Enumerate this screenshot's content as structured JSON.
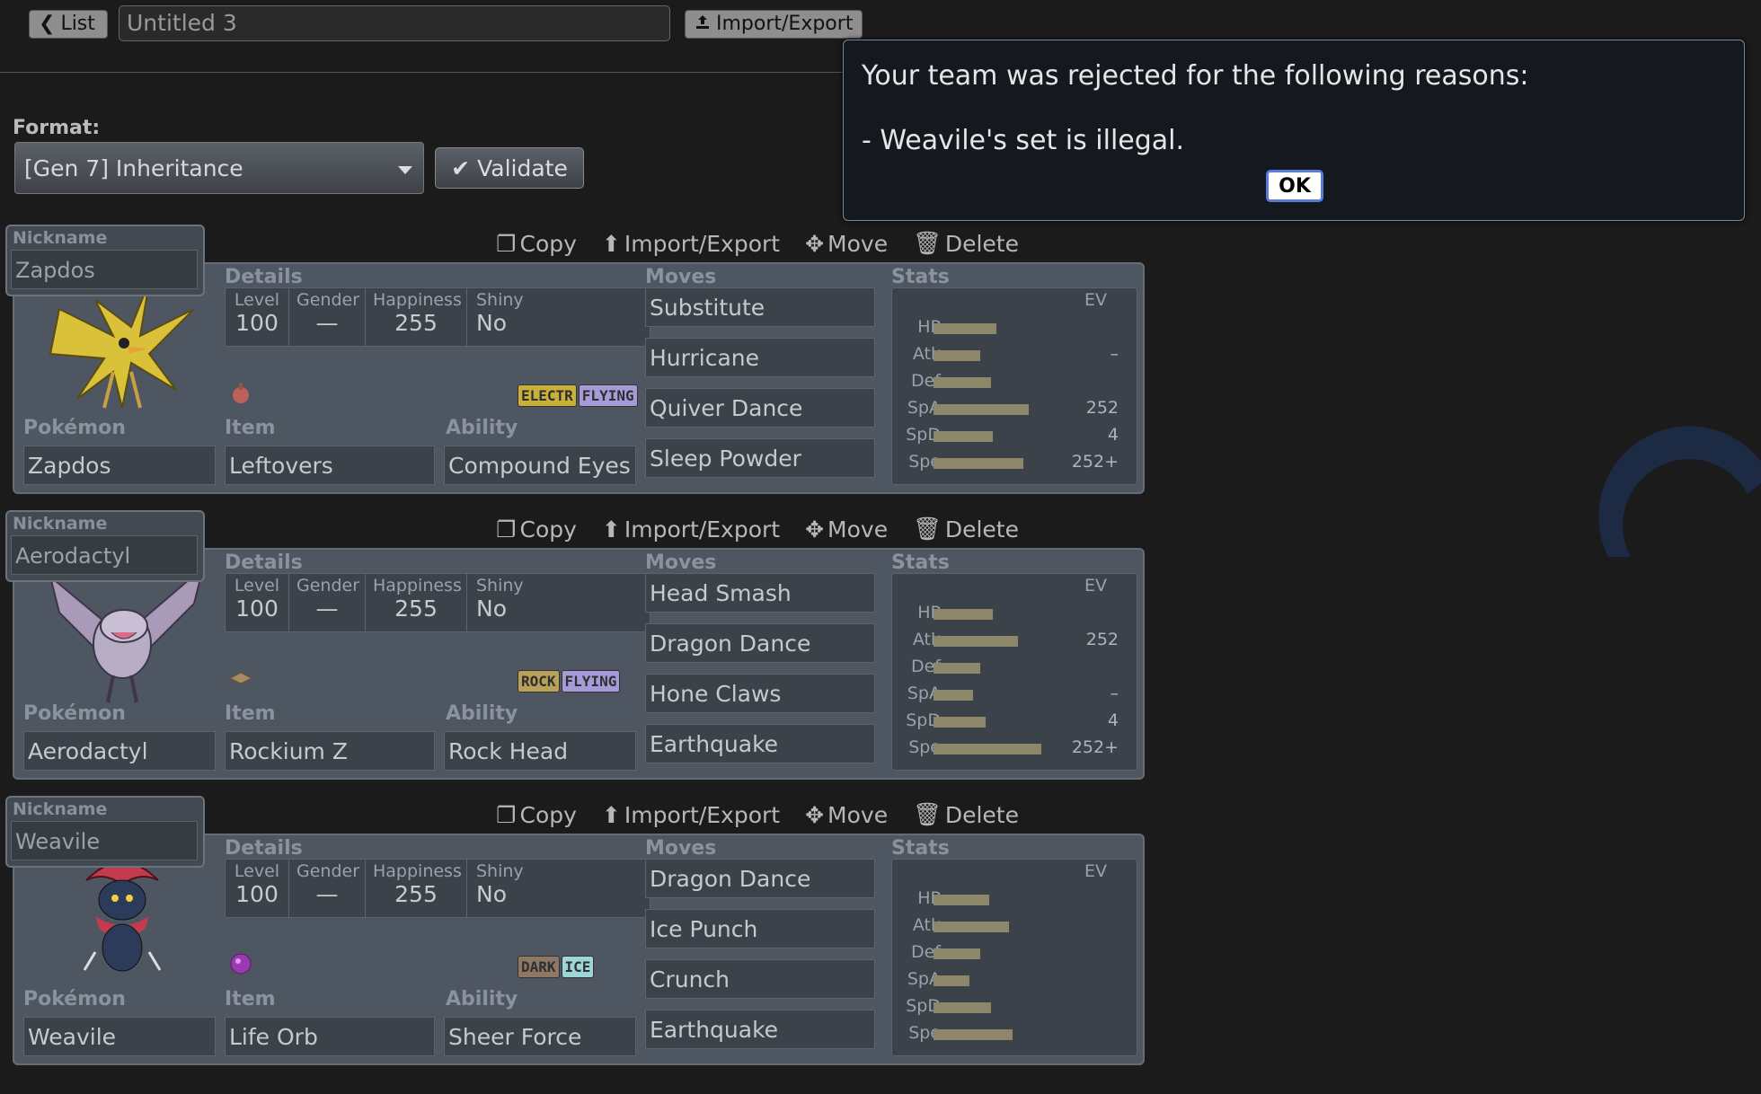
{
  "toolbar": {
    "list_label": "List",
    "team_name": "Untitled 3",
    "import_export_label": "Import/Export"
  },
  "format": {
    "label": "Format:",
    "selected": "[Gen 7] Inheritance",
    "validate_label": "Validate"
  },
  "actions": {
    "copy": "Copy",
    "import_export": "Import/Export",
    "move": "Move",
    "delete": "Delete"
  },
  "labels": {
    "nickname": "Nickname",
    "details": "Details",
    "moves": "Moves",
    "stats": "Stats",
    "pokemon": "Pokémon",
    "item": "Item",
    "ability": "Ability",
    "level": "Level",
    "gender": "Gender",
    "happiness": "Happiness",
    "shiny": "Shiny",
    "ev": "EV"
  },
  "team": [
    {
      "nickname": "Zapdos",
      "species": "Zapdos",
      "level": "100",
      "gender": "—",
      "happiness": "255",
      "shiny": "No",
      "item": "Leftovers",
      "ability": "Compound Eyes",
      "types": [
        {
          "name": "ELECTR",
          "color": "#c9b03a"
        },
        {
          "name": "FLYING",
          "color": "#a79ad8"
        }
      ],
      "moves": [
        "Substitute",
        "Hurricane",
        "Quiver Dance",
        "Sleep Powder"
      ],
      "stats": [
        {
          "name": "HP",
          "ev": "",
          "bar": 0.35
        },
        {
          "name": "Atk",
          "ev": "–",
          "bar": 0.26
        },
        {
          "name": "Def",
          "ev": "",
          "bar": 0.32
        },
        {
          "name": "SpA",
          "ev": "252",
          "bar": 0.53
        },
        {
          "name": "SpD",
          "ev": "4",
          "bar": 0.33
        },
        {
          "name": "Spe",
          "ev": "252+",
          "bar": 0.5
        }
      ]
    },
    {
      "nickname": "Aerodactyl",
      "species": "Aerodactyl",
      "level": "100",
      "gender": "—",
      "happiness": "255",
      "shiny": "No",
      "item": "Rockium Z",
      "ability": "Rock Head",
      "types": [
        {
          "name": "ROCK",
          "color": "#b8a158"
        },
        {
          "name": "FLYING",
          "color": "#a79ad8"
        }
      ],
      "moves": [
        "Head Smash",
        "Dragon Dance",
        "Hone Claws",
        "Earthquake"
      ],
      "stats": [
        {
          "name": "HP",
          "ev": "",
          "bar": 0.33
        },
        {
          "name": "Atk",
          "ev": "252",
          "bar": 0.47
        },
        {
          "name": "Def",
          "ev": "",
          "bar": 0.26
        },
        {
          "name": "SpA",
          "ev": "–",
          "bar": 0.22
        },
        {
          "name": "SpD",
          "ev": "4",
          "bar": 0.29
        },
        {
          "name": "Spe",
          "ev": "252+",
          "bar": 0.6
        }
      ]
    },
    {
      "nickname": "Weavile",
      "species": "Weavile",
      "level": "100",
      "gender": "—",
      "happiness": "255",
      "shiny": "No",
      "item": "Life Orb",
      "ability": "Sheer Force",
      "types": [
        {
          "name": "DARK",
          "color": "#8f7766"
        },
        {
          "name": "ICE",
          "color": "#9cd6d6"
        }
      ],
      "moves": [
        "Dragon Dance",
        "Ice Punch",
        "Crunch",
        "Earthquake"
      ],
      "stats": [
        {
          "name": "HP",
          "ev": "",
          "bar": 0.31
        },
        {
          "name": "Atk",
          "ev": "",
          "bar": 0.42
        },
        {
          "name": "Def",
          "ev": "",
          "bar": 0.26
        },
        {
          "name": "SpA",
          "ev": "",
          "bar": 0.2
        },
        {
          "name": "SpD",
          "ev": "",
          "bar": 0.32
        },
        {
          "name": "Spe",
          "ev": "",
          "bar": 0.44
        }
      ]
    }
  ],
  "modal": {
    "line1": "Your team was rejected for the following reasons:",
    "line2": "- Weavile's set is illegal.",
    "ok_label": "OK"
  },
  "colors": {
    "stat_bar": "#8c866b",
    "ok_border": "#5a7bd6"
  }
}
